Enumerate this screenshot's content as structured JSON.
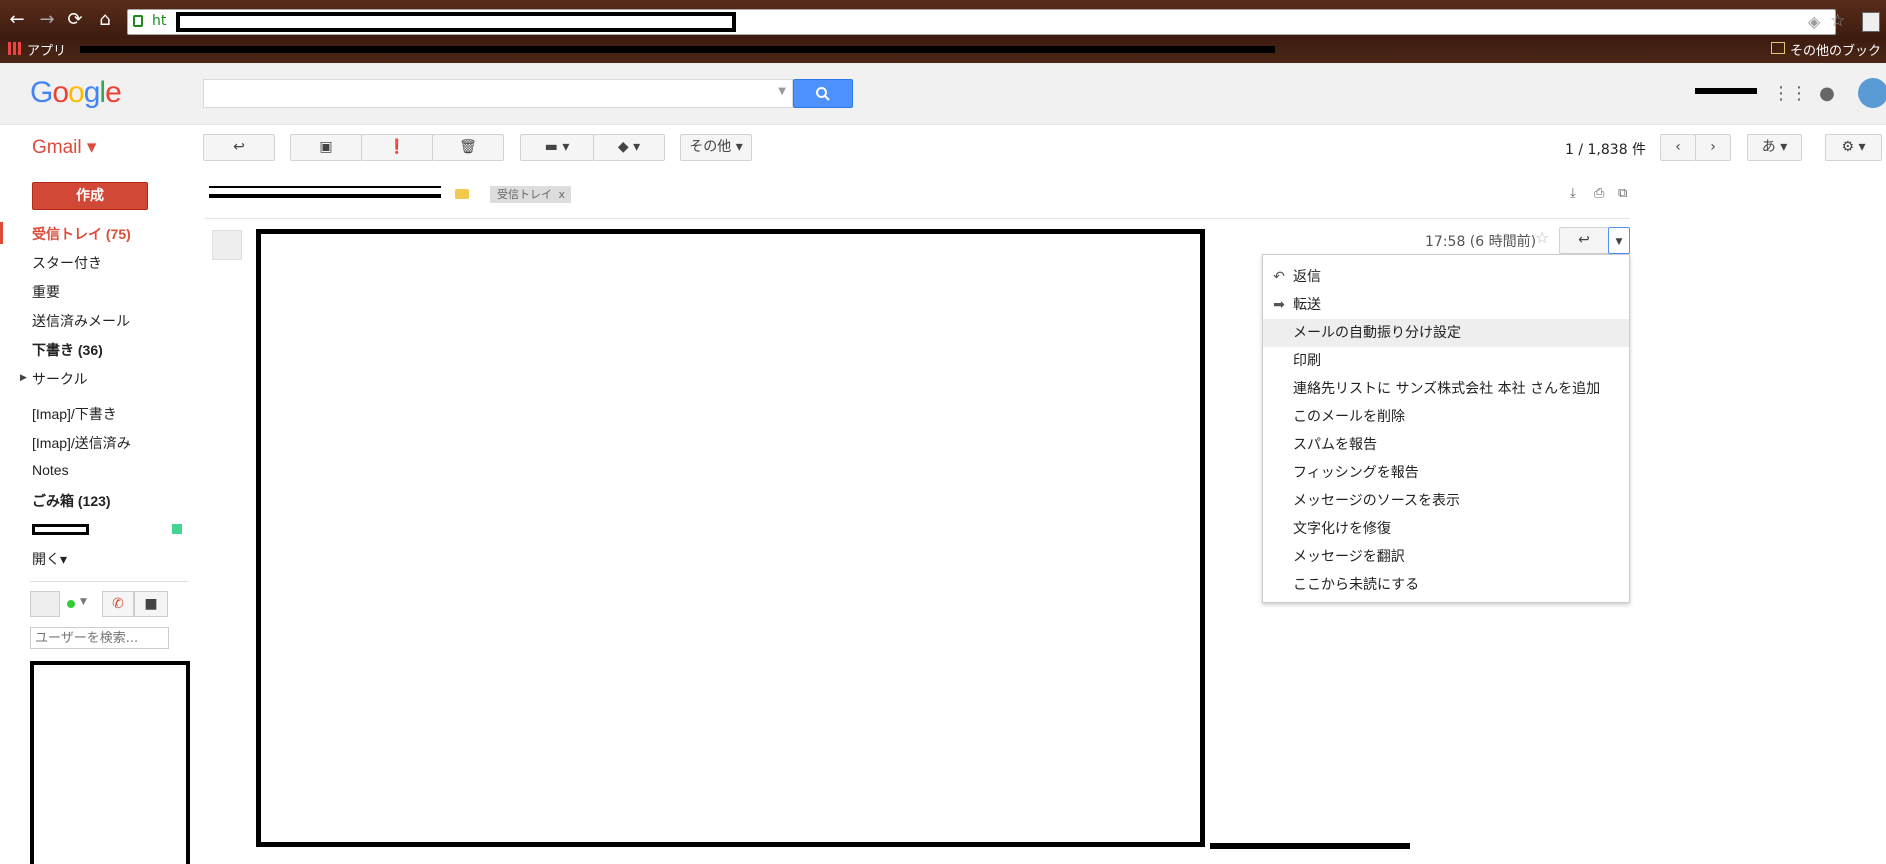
{
  "browser": {
    "url_prefix": "ht",
    "bookmarks_apps": "アプリ",
    "bookmarks_other": "その他のブックマ"
  },
  "header": {
    "logo": [
      "G",
      "o",
      "o",
      "g",
      "l",
      "e"
    ],
    "logo_colors": [
      "#4285f4",
      "#ea4335",
      "#fbbc05",
      "#4285f4",
      "#34a853",
      "#ea4335"
    ],
    "search_placeholder": ""
  },
  "toolbar": {
    "gmail_label": "Gmail ▾",
    "more_label": "その他 ▾",
    "page_count": "1 / 1,838 件",
    "ime_label": "あ"
  },
  "sidebar": {
    "compose": "作成",
    "items": [
      {
        "label": "受信トレイ (75)",
        "style": "red"
      },
      {
        "label": "スター付き",
        "style": ""
      },
      {
        "label": "重要",
        "style": ""
      },
      {
        "label": "送信済みメール",
        "style": ""
      },
      {
        "label": "下書き (36)",
        "style": "bold"
      },
      {
        "label": "サークル",
        "style": ""
      },
      {
        "label": "[Imap]/下書き",
        "style": ""
      },
      {
        "label": "[Imap]/送信済み",
        "style": ""
      },
      {
        "label": "Notes",
        "style": ""
      },
      {
        "label": "ごみ箱 (123)",
        "style": "bold"
      }
    ],
    "open_label": "開く▾",
    "user_search_placeholder": "ユーザーを検索..."
  },
  "message": {
    "label_chip": "受信トレイ",
    "label_chip_close": "x",
    "time": "17:58 (6 時間前)"
  },
  "menu": {
    "items": [
      {
        "label": "返信",
        "icon": "reply-icon"
      },
      {
        "label": "転送",
        "icon": "forward-icon"
      },
      {
        "label": "メールの自動振り分け設定",
        "icon": "",
        "highlight": true
      },
      {
        "label": "印刷",
        "icon": ""
      },
      {
        "label": "連絡先リストに サンズ株式会社 本社 さんを追加",
        "icon": ""
      },
      {
        "label": "このメールを削除",
        "icon": ""
      },
      {
        "label": "スパムを報告",
        "icon": ""
      },
      {
        "label": "フィッシングを報告",
        "icon": ""
      },
      {
        "label": "メッセージのソースを表示",
        "icon": ""
      },
      {
        "label": "文字化けを修復",
        "icon": ""
      },
      {
        "label": "メッセージを翻訳",
        "icon": ""
      },
      {
        "label": "ここから未読にする",
        "icon": ""
      }
    ]
  }
}
